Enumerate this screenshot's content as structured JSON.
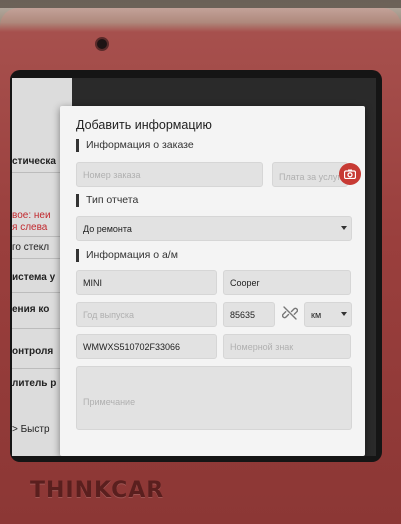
{
  "device": {
    "brand": "THINKCAR"
  },
  "background_app": {
    "rows": [
      {
        "text": "стическа",
        "red": false
      },
      {
        "text": "вое: неи",
        "red": true
      },
      {
        "text": "я слева",
        "red": true
      },
      {
        "text": "го стекл",
        "red": false
      },
      {
        "text": "истема у",
        "red": false
      },
      {
        "text": "ения ко",
        "red": false
      },
      {
        "text": "онтроля",
        "red": false
      },
      {
        "text": "литель р",
        "red": false
      },
      {
        "text": "> Быстр",
        "red": false
      }
    ]
  },
  "dialog": {
    "title": "Добавить информацию",
    "order_section": {
      "title": "Информация о заказе",
      "order_number_placeholder": "Номер заказа",
      "service_fee_placeholder": "Плата за услуги"
    },
    "report_section": {
      "title": "Тип отчета",
      "report_type_value": "До ремонта"
    },
    "vehicle_section": {
      "title": "Информация о а/м",
      "make_value": "MINI",
      "model_value": "Cooper",
      "year_placeholder": "Год выпуска",
      "mileage_value": "85635",
      "unit_value": "км",
      "vin_value": "WMWXS510702F33066",
      "plate_placeholder": "Номерной знак",
      "notes_placeholder": "Примечание"
    }
  },
  "icons": {
    "camera": "camera-icon",
    "link": "link-icon",
    "dropdown": "chevron-down-icon"
  },
  "colors": {
    "device_red": "#9a3f3d",
    "accent_red": "#c73a34",
    "dialog_bg": "#f4f4f4",
    "field_bg": "#e2e2e2"
  }
}
